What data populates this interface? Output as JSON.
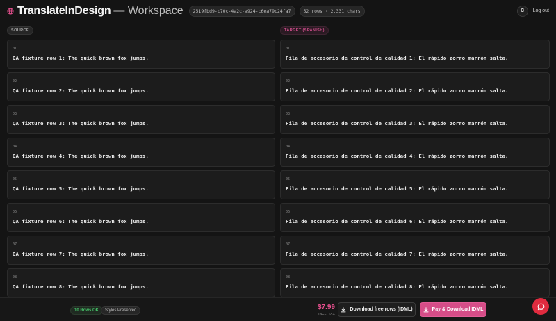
{
  "header": {
    "brand": "TranslateInDesign",
    "section": "— Workspace",
    "job_id": "2519fbd9-c70c-4a2c-a924-c6ea79c24fa7",
    "stats": "52 rows · 2,331 chars",
    "avatar_initial": "C",
    "logout_label": "Log out"
  },
  "source": {
    "label": "SOURCE",
    "rows": [
      {
        "num": "01",
        "text": "QA fixture row 1: The quick brown fox jumps."
      },
      {
        "num": "02",
        "text": "QA fixture row 2: The quick brown fox jumps."
      },
      {
        "num": "03",
        "text": "QA fixture row 3: The quick brown fox jumps."
      },
      {
        "num": "04",
        "text": "QA fixture row 4: The quick brown fox jumps."
      },
      {
        "num": "05",
        "text": "QA fixture row 5: The quick brown fox jumps."
      },
      {
        "num": "06",
        "text": "QA fixture row 6: The quick brown fox jumps."
      },
      {
        "num": "07",
        "text": "QA fixture row 7: The quick brown fox jumps."
      },
      {
        "num": "08",
        "text": "QA fixture row 8: The quick brown fox jumps."
      }
    ]
  },
  "target": {
    "label": "TARGET (SPANISH)",
    "rows": [
      {
        "num": "01",
        "text": "Fila de accesorio de control de calidad 1: El rápido zorro marrón salta."
      },
      {
        "num": "02",
        "text": "Fila de accesorio de control de calidad 2: El rápido zorro marrón salta."
      },
      {
        "num": "03",
        "text": "Fila de accesorio de control de calidad 3: El rápido zorro marrón salta."
      },
      {
        "num": "04",
        "text": "Fila de accesorio de control de calidad 4: El rápido zorro marrón salta."
      },
      {
        "num": "05",
        "text": "Fila de accesorio de control de calidad 5: El rápido zorro marrón salta."
      },
      {
        "num": "06",
        "text": "Fila de accesorio de control de calidad 6: El rápido zorro marrón salta."
      },
      {
        "num": "07",
        "text": "Fila de accesorio de control de calidad 7: El rápido zorro marrón salta."
      },
      {
        "num": "08",
        "text": "Fila de accesorio de control de calidad 8: El rápido zorro marrón salta."
      }
    ]
  },
  "footer": {
    "rows_ok": "10 Rows OK",
    "styles": "Styles Preserved",
    "price": "$7.99",
    "tax": "INCL. TAX",
    "free_button": "Download free rows (IDML)",
    "pay_button": "Pay & Download IDML"
  },
  "icons": {
    "logo": "globe-icon",
    "download": "download-icon",
    "chat": "chat-icon"
  },
  "colors": {
    "accent": "#d64d88",
    "ok": "#46c46a",
    "chat": "#e02b3f"
  }
}
